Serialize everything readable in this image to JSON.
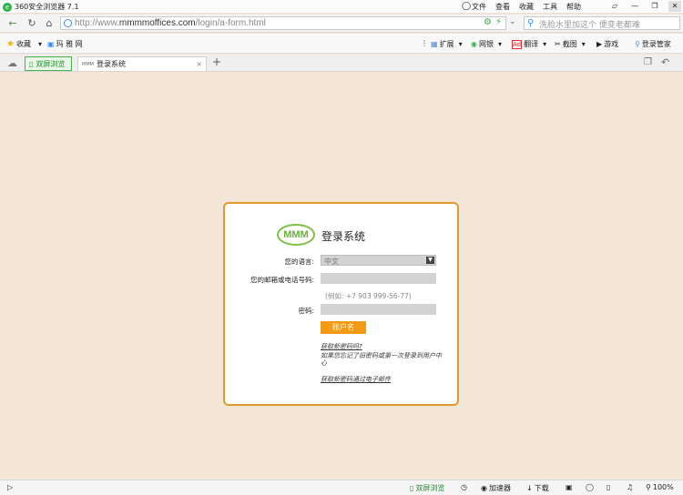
{
  "browser": {
    "app_title": "360安全浏览器 7.1",
    "menu": [
      "文件",
      "查看",
      "收藏",
      "工具",
      "帮助"
    ],
    "url_prefix": "http://www.",
    "url_domain": "mmmmoffices.com",
    "url_path": "/login/a-form.html",
    "search_placeholder": "洗脸水里加这个 便变老都难",
    "bookmarks": {
      "fav_label": "收藏",
      "net_label": "玛 雅 网",
      "ext_label": "扩展",
      "netbank_label": "网银",
      "translate_label": "翻译",
      "screenshot_label": "截图",
      "games_label": "游戏",
      "login_manager_label": "登录管家"
    },
    "tabs": {
      "green_tab_label": "双屏浏览",
      "active_tab_favicon": "MMM",
      "active_tab_label": "登录系统"
    },
    "status": {
      "dual_screen": "双屏浏览",
      "accelerator": "加速器",
      "download": "下载",
      "zoom": "100%"
    }
  },
  "login": {
    "logo_text": "MMM",
    "title": "登录系统",
    "language_label": "您的语言:",
    "language_value": "中文",
    "account_label": "您的邮箱或电话号码:",
    "account_hint": "(例如: +7 903 999-56-77)",
    "password_label": "密码:",
    "login_button": "账户名",
    "forgot_link": "获取新密码吗?",
    "message": "如果您忘记了旧密码或第一次登录到用户中心",
    "email_link": "获取新密码通过电子邮件"
  },
  "colors": {
    "background": "#f3e6d6",
    "card_border": "#e19a2e",
    "button": "#f39a17",
    "logo_green": "#7bc142"
  }
}
